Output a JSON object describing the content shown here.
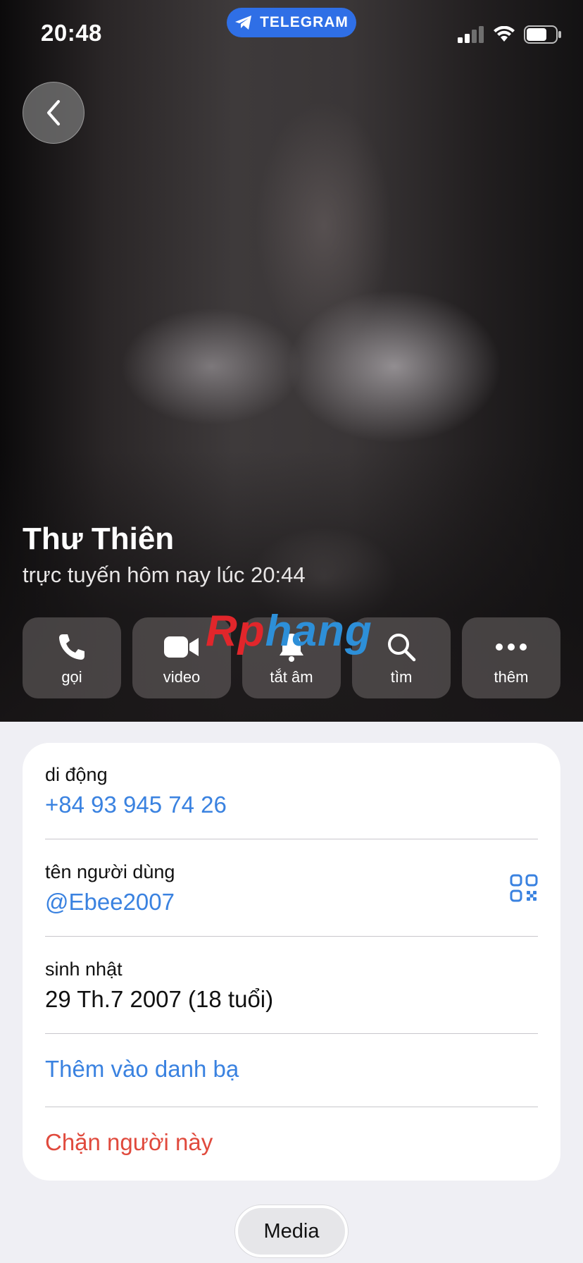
{
  "status_bar": {
    "time": "20:48",
    "app_label": "TELEGRAM"
  },
  "profile": {
    "name": "Thư Thiên",
    "last_seen": "trực tuyến hôm nay lúc 20:44"
  },
  "actions": [
    {
      "label": "gọi",
      "icon": "phone-icon"
    },
    {
      "label": "video",
      "icon": "video-icon"
    },
    {
      "label": "tắt âm",
      "icon": "bell-icon"
    },
    {
      "label": "tìm",
      "icon": "search-icon"
    },
    {
      "label": "thêm",
      "icon": "more-icon"
    }
  ],
  "watermark": {
    "part1": "Rp",
    "part2": "hang"
  },
  "info": {
    "phone_label": "di động",
    "phone_value": "+84 93 945 74 26",
    "username_label": "tên người dùng",
    "username_value": "@Ebee2007",
    "birthday_label": "sinh nhật",
    "birthday_value": "29 Th.7 2007 (18 tuổi)",
    "add_contact": "Thêm vào danh bạ",
    "block_user": "Chặn người này"
  },
  "media_tab": "Media",
  "colors": {
    "link": "#3a82e0",
    "danger": "#e04a3d",
    "telegram": "#2f6fe6"
  }
}
